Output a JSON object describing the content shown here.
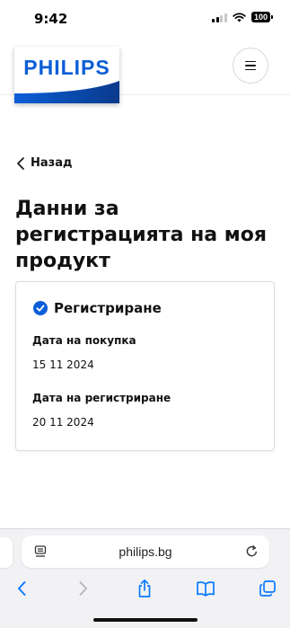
{
  "status_bar": {
    "time": "9:42",
    "battery": "100"
  },
  "header": {
    "logo_text": "PHILIPS",
    "brand_color": "#0b5ed7"
  },
  "back_link": {
    "label": "Назад"
  },
  "page": {
    "title": "Данни за регистрацията на моя продукт"
  },
  "card": {
    "status_label": "Регистриране",
    "purchase_date_label": "Дата на покупка",
    "purchase_date_value": "15 11 2024",
    "registration_date_label": "Дата на регистриране",
    "registration_date_value": "20 11 2024",
    "check_color": "#0b5ed7"
  },
  "browser": {
    "url": "philips.bg",
    "accent_color": "#0a7aff"
  },
  "icons": [
    "signal-icon",
    "wifi-icon",
    "battery-icon",
    "menu-icon",
    "chevron-left-icon",
    "check-circle-icon",
    "page-menu-icon",
    "reload-icon",
    "back-icon",
    "forward-icon",
    "share-icon",
    "bookmarks-icon",
    "tabs-icon"
  ]
}
